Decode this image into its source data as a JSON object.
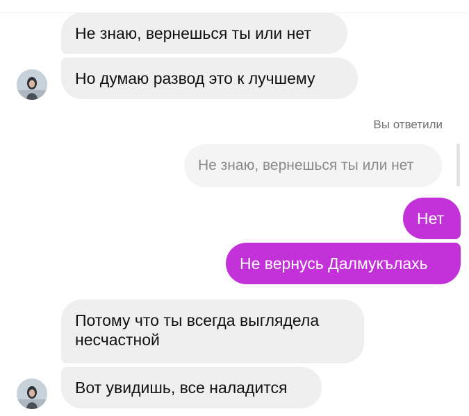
{
  "messages": [
    {
      "id": "m1",
      "direction": "incoming",
      "text": "Не знаю, вернешься ты или нет"
    },
    {
      "id": "m2",
      "direction": "incoming",
      "text": "Но думаю развод это к лучшему"
    },
    {
      "id": "reply",
      "label": "Вы ответили",
      "quoted_text": "Не знаю, вернешься ты или нет"
    },
    {
      "id": "m3",
      "direction": "outgoing",
      "text": "Нет"
    },
    {
      "id": "m4",
      "direction": "outgoing",
      "text": "Не вернусь Далмукълахь"
    },
    {
      "id": "m5",
      "direction": "incoming",
      "text": "Потому что ты всегда выглядела несчастной"
    },
    {
      "id": "m6",
      "direction": "incoming",
      "text": "Вот увидишь, все наладится"
    }
  ],
  "colors": {
    "outgoing_bubble": "#c331d8",
    "incoming_bubble": "#efefef",
    "reply_quote_bubble": "#f4f4f4",
    "reply_label_text": "#707070"
  },
  "icons": {
    "contact_avatar": "contact-avatar-photo"
  }
}
